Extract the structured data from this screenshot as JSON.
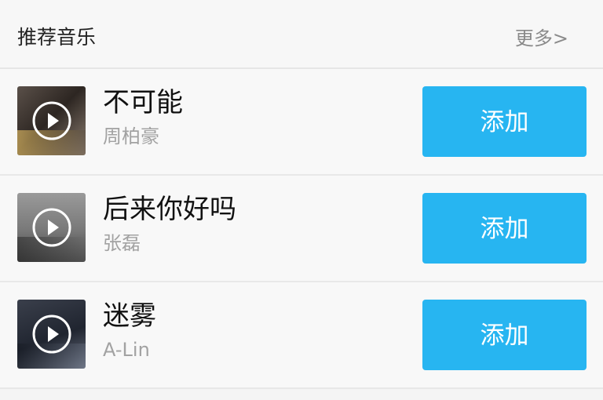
{
  "header": {
    "title": "推荐音乐",
    "more_label": "更多>"
  },
  "songs": [
    {
      "title": "不可能",
      "artist": "周柏豪",
      "button_label": "添加",
      "cover_icon": "play-circle-icon"
    },
    {
      "title": "后来你好吗",
      "artist": "张磊",
      "button_label": "添加",
      "cover_icon": "play-circle-icon"
    },
    {
      "title": "迷雾",
      "artist": "A-Lin",
      "button_label": "添加",
      "cover_icon": "play-circle-icon"
    }
  ],
  "colors": {
    "button_bg": "#27b5f1",
    "button_text": "#ffffff",
    "title_text": "#111111",
    "artist_text": "#a2a2a2",
    "more_text": "#8a8a8a"
  }
}
